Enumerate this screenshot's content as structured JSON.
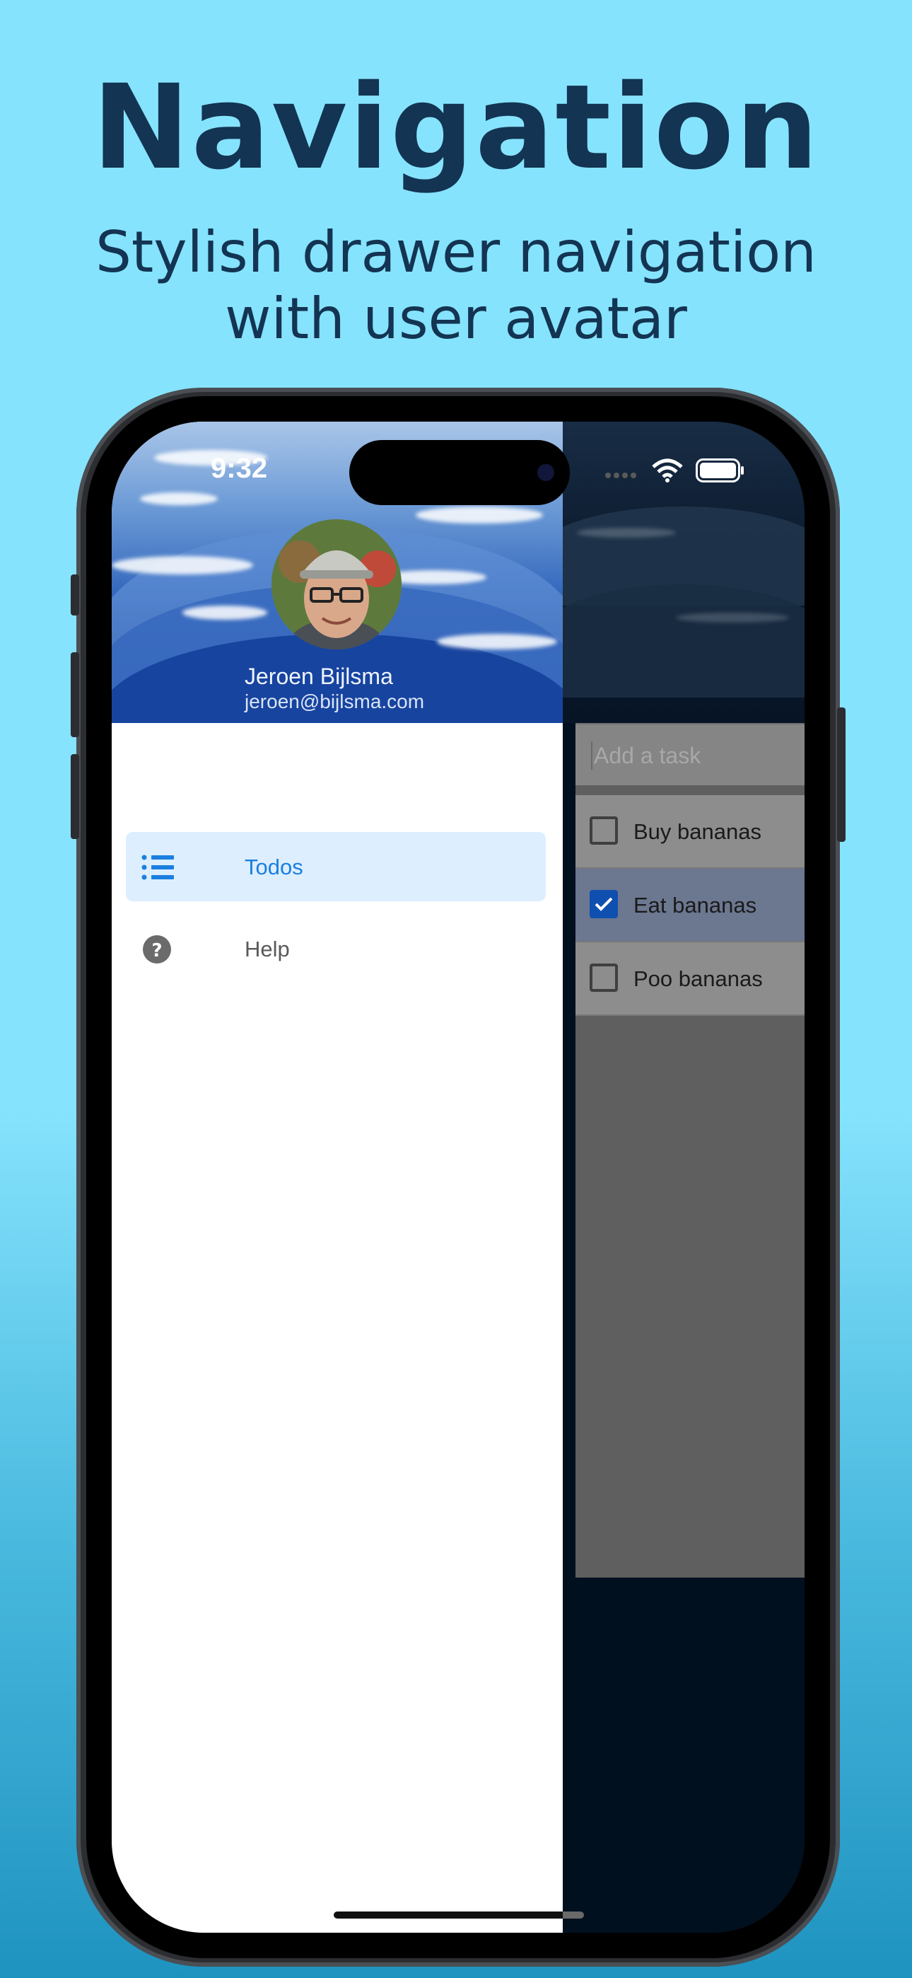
{
  "promo": {
    "headline": "Navigation",
    "subhead_line1": "Stylish drawer navigation",
    "subhead_line2": "with user avatar"
  },
  "status_bar": {
    "time": "9:32",
    "icons": [
      "signal-dots-icon",
      "wifi-icon",
      "battery-icon"
    ]
  },
  "drawer": {
    "user": {
      "name": "Jeroen Bijlsma",
      "email": "jeroen@bijlsma.com"
    },
    "items": [
      {
        "label": "Todos",
        "icon": "list-icon",
        "active": true
      },
      {
        "label": "Help",
        "icon": "help-icon",
        "active": false
      }
    ]
  },
  "todo": {
    "input_placeholder": "Add a task",
    "tasks": [
      {
        "label": "Buy bananas",
        "done": false
      },
      {
        "label": "Eat bananas",
        "done": true
      },
      {
        "label": "Poo bananas",
        "done": false
      }
    ]
  },
  "colors": {
    "background": "#86e3fd",
    "headline": "#133452",
    "accent": "#1b7fe0",
    "active_item_bg": "#ddeeff"
  }
}
